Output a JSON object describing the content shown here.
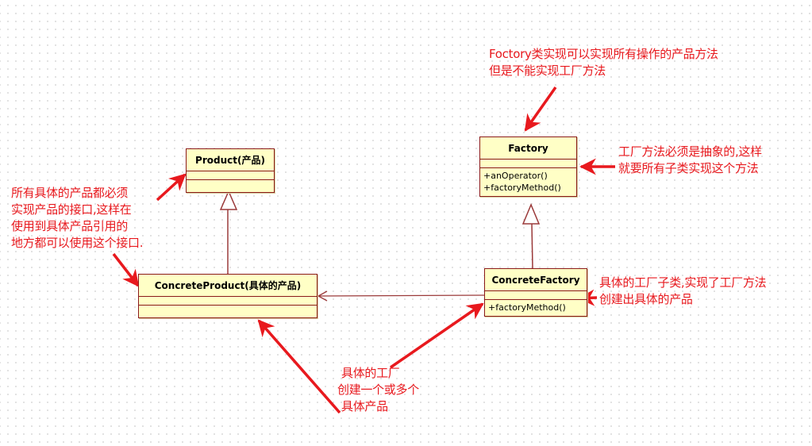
{
  "diagram": {
    "type": "uml-class-diagram",
    "pattern": "factory-method",
    "colors": {
      "class_fill": "#ffffc6",
      "class_border": "#8b1a1a",
      "relation_line": "#9b3a3a",
      "annotation": "#e8191e"
    },
    "classes": {
      "product": {
        "name": "Product(产品)",
        "attributes": [],
        "operations": []
      },
      "concrete_product": {
        "name": "ConcreteProduct(具体的产品)",
        "attributes": [],
        "operations": []
      },
      "factory": {
        "name": "Factory",
        "attributes": [],
        "operations": [
          "+anOperator()",
          "+factoryMethod()"
        ]
      },
      "concrete_factory": {
        "name": "ConcreteFactory",
        "attributes": [],
        "operations": [
          "+factoryMethod()"
        ]
      }
    },
    "relations": [
      {
        "type": "generalization",
        "from": "ConcreteProduct(具体的产品)",
        "to": "Product(产品)"
      },
      {
        "type": "generalization",
        "from": "ConcreteFactory",
        "to": "Factory"
      },
      {
        "type": "dependency",
        "from": "ConcreteFactory",
        "to": "ConcreteProduct(具体的产品)"
      }
    ],
    "annotations": {
      "factory_top": {
        "lines": [
          "Foctory类实现可以实现所有操作的产品方法",
          "但是不能实现工厂方法"
        ],
        "target": "Factory"
      },
      "factory_right": {
        "lines": [
          "工厂方法必须是抽象的,这样",
          "就要所有子类实现这个方法"
        ],
        "target": "Factory"
      },
      "product_left": {
        "lines": [
          "所有具体的产品都必须",
          "实现产品的接口,这样在",
          "使用到具体产品引用的",
          "地方都可以使用这个接口."
        ],
        "target": "Product(产品)"
      },
      "concrete_factory_right": {
        "lines": [
          "具体的工厂子类,实现了工厂方法",
          "创建出具体的产品"
        ],
        "target": "ConcreteFactory"
      },
      "bottom": {
        "lines": [
          "具体的工厂",
          "创建一个或多个",
          "具体产品"
        ],
        "targets": [
          "ConcreteFactory",
          "ConcreteProduct(具体的产品)"
        ]
      }
    }
  }
}
